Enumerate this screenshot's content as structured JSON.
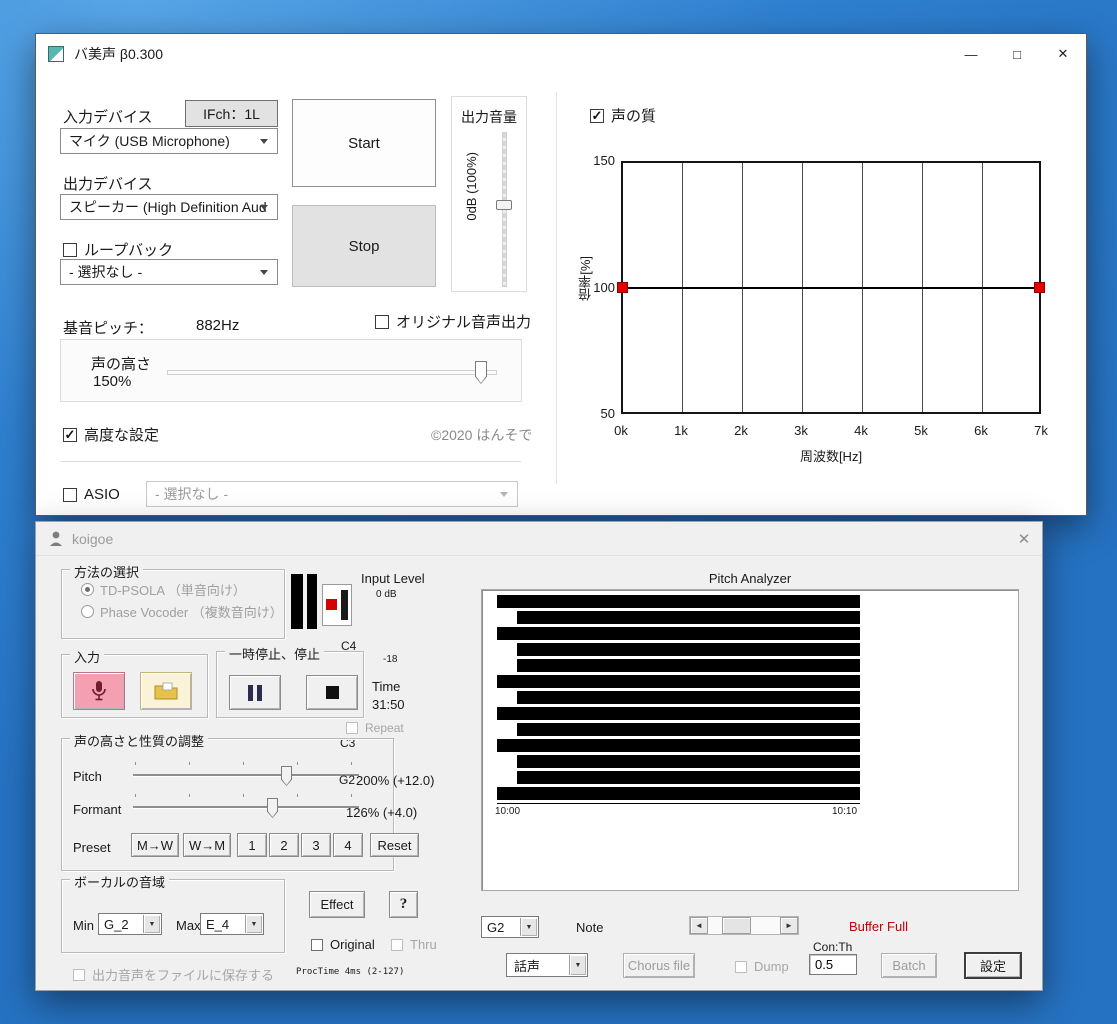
{
  "icons": {
    "check": "✓",
    "dropdown": "▼",
    "minimize": "—",
    "maximize": "□",
    "close": "✕",
    "scroll_left": "◄",
    "scroll_right": "►",
    "help": "?"
  },
  "win1": {
    "title": "バ美声 β0.300",
    "left": {
      "input_device_label": "入力デバイス",
      "ifch_button": "IFch：1L",
      "input_device_value": "マイク (USB Microphone)",
      "output_device_label": "出力デバイス",
      "output_device_value": "スピーカー (High Definition Aud",
      "loopback_label": "ループバック",
      "loopback_device_value": "- 選択なし -",
      "base_pitch_label": "基音ピッチ：",
      "base_pitch_value": "882Hz",
      "voice_pitch_label": "声の高さ",
      "voice_pitch_value": "150%",
      "advanced_label": "高度な設定",
      "copyright": "©2020 はんそで",
      "asio_label": "ASIO",
      "asio_device_value": "- 選択なし -"
    },
    "center": {
      "start_button": "Start",
      "stop_button": "Stop",
      "output_volume_label": "出力音量",
      "output_volume_value": "0dB (100%)",
      "original_output_label": "オリジナル音声出力"
    },
    "right": {
      "voice_quality_label": "声の質"
    },
    "chart_data": {
      "type": "line",
      "title": "",
      "xlabel": "周波数[Hz]",
      "ylabel": "倍率[%]",
      "x_ticks": [
        "0k",
        "1k",
        "2k",
        "3k",
        "4k",
        "5k",
        "6k",
        "7k"
      ],
      "y_ticks": [
        "150",
        "100",
        "50"
      ],
      "ylim": [
        50,
        150
      ],
      "xlim_hz": [
        0,
        7000
      ],
      "grid": "vertical",
      "series": [
        {
          "name": "倍率",
          "x_hz": [
            0,
            7000
          ],
          "values": [
            100,
            100
          ]
        }
      ],
      "marker_color": "#e60000",
      "line_color": "#000000"
    }
  },
  "win2": {
    "title": "koigoe",
    "method_group": {
      "title": "方法の選択",
      "option1": "TD-PSOLA （単音向け）",
      "option2": "Phase Vocoder （複数音向け）",
      "selected": "TD-PSOLA （単音向け）"
    },
    "meter": {
      "input_level_label": "Input Level",
      "input_level_value": "0 dB",
      "note_top": "C4",
      "db_mark": "-18"
    },
    "input_group": {
      "title": "入力"
    },
    "pause_group": {
      "title": "一時停止、停止"
    },
    "time_label": "Time",
    "time_value": "31:50",
    "repeat_label": "Repeat",
    "adjust_group": {
      "title": "声の高さと性質の調整",
      "note_c3": "C3",
      "note_g2": "G2",
      "pitch_label": "Pitch",
      "pitch_value": "200% (+12.0)",
      "formant_label": "Formant",
      "formant_value": "126% (+4.0)",
      "preset_label": "Preset",
      "presets": [
        "M→W",
        "W→M",
        "1",
        "2",
        "3",
        "4",
        "Reset"
      ]
    },
    "range_group": {
      "title": "ボーカルの音域",
      "min_label": "Min",
      "min_value": "G_2",
      "max_label": "Max",
      "max_value": "E_4"
    },
    "effect_button": "Effect",
    "original_label": "Original",
    "thru_label": "Thru",
    "save_file_label": "出力音声をファイルに保存する",
    "proc_time": "ProcTime 4ms (2-127)",
    "analyzer": {
      "title": "Pitch Analyzer",
      "time_start": "10:00",
      "time_end": "10:10",
      "key_pattern": [
        "b",
        "w",
        "b",
        "w",
        "w",
        "b",
        "w",
        "b",
        "w",
        "b",
        "w",
        "w",
        "b"
      ],
      "note_value": "G2",
      "note_label": "Note",
      "buffer_status": "Buffer Full",
      "conth_label": "Con:Th",
      "conth_value": "0.5",
      "voice_value": "話声",
      "chorus_button": "Chorus file",
      "dump_label": "Dump",
      "batch_button": "Batch",
      "settings_button": "設定"
    }
  }
}
